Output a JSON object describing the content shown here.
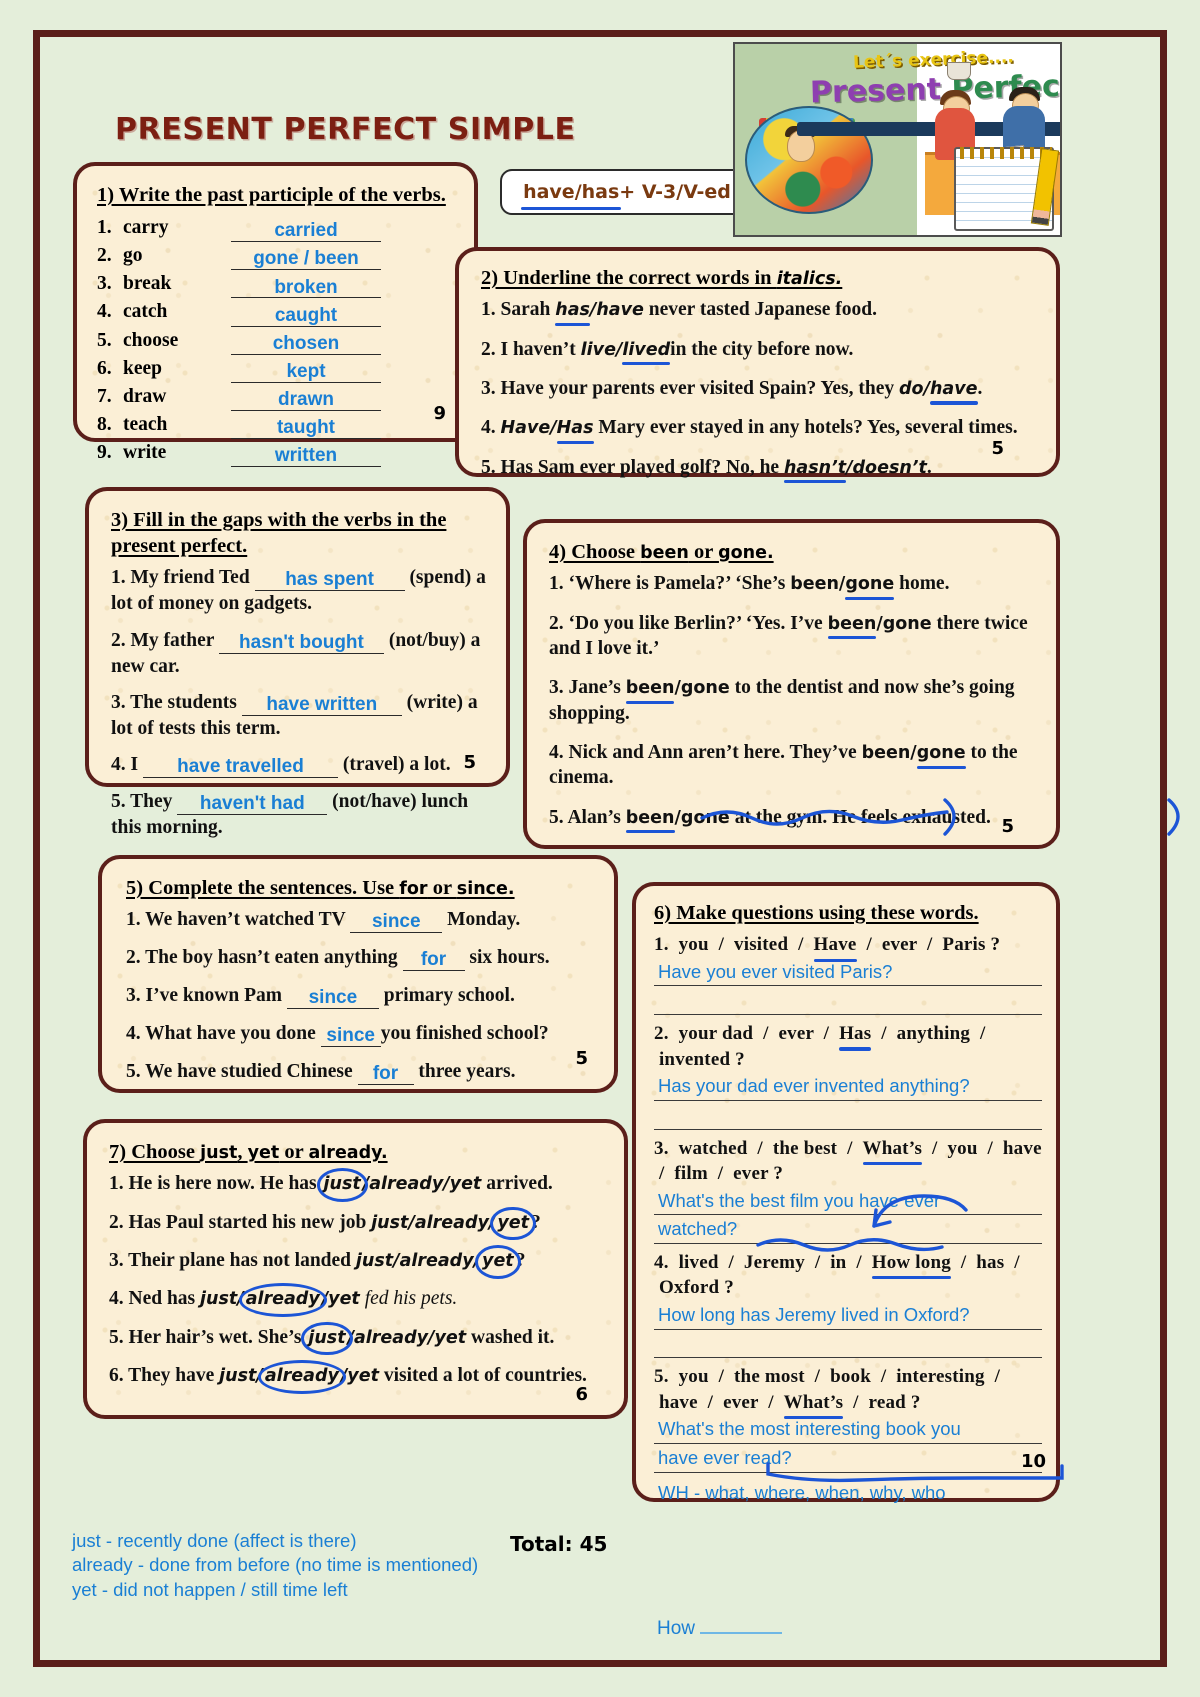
{
  "title": "PRESENT PERFECT SIMPLE",
  "formula": {
    "underlined": "have/has",
    "rest": " + V-3/V-ed"
  },
  "clipart": {
    "lets": "Let´s exercise....",
    "p1": "Present",
    "p2": " Perfect"
  },
  "ex1": {
    "heading": "1) Write the past participle of the verbs.",
    "items": [
      {
        "n": "1.",
        "verb": "carry",
        "answer": "carried"
      },
      {
        "n": "2.",
        "verb": "go",
        "answer": "gone / been"
      },
      {
        "n": "3.",
        "verb": "break",
        "answer": "broken"
      },
      {
        "n": "4.",
        "verb": "catch",
        "answer": "caught"
      },
      {
        "n": "5.",
        "verb": "choose",
        "answer": "chosen"
      },
      {
        "n": "6.",
        "verb": "keep",
        "answer": "kept"
      },
      {
        "n": "7.",
        "verb": "draw",
        "answer": "drawn"
      },
      {
        "n": "8.",
        "verb": "teach",
        "answer": "taught"
      },
      {
        "n": "9.",
        "verb": "write",
        "answer": "written"
      }
    ],
    "score": "9"
  },
  "ex2": {
    "heading_plain": "2) Underline the correct words in ",
    "heading_italic": "italics.",
    "items": [
      {
        "n": "1.",
        "pre": "Sarah ",
        "opt_a": "has",
        "opt_b": "have",
        "chosen": "a",
        "post": " never tasted Japanese food."
      },
      {
        "n": "2.",
        "pre": "I haven’t ",
        "opt_a": "live",
        "opt_b": "lived",
        "chosen": "b",
        "post": "in the city before now."
      },
      {
        "n": "3.",
        "pre": "Have your parents ever visited Spain? Yes, they ",
        "opt_a": "do",
        "opt_b": "have",
        "chosen": "b",
        "post": "."
      },
      {
        "n": "4.",
        "pre": "",
        "opt_a": "Have",
        "opt_b": "Has",
        "chosen": "b",
        "post": " Mary ever stayed in any hotels? Yes, several times."
      },
      {
        "n": "5.",
        "pre": "Has Sam ever played golf? No, he ",
        "opt_a": "hasn’t",
        "opt_b": "doesn’t",
        "chosen": "a",
        "post": "."
      }
    ],
    "score": "5"
  },
  "ex3": {
    "heading": "3) Fill in the gaps with the verbs in the present perfect.",
    "items": [
      {
        "n": "1.",
        "pre": "My friend Ted ",
        "answer": "has spent",
        "post": " (spend) a lot of money on gadgets."
      },
      {
        "n": "2.",
        "pre": "My father ",
        "answer": "hasn't bought",
        "post": " (not/buy) a new car."
      },
      {
        "n": "3.",
        "pre": "The students ",
        "answer": "have written",
        "post": " (write) a lot of tests this term."
      },
      {
        "n": "4.",
        "pre": "I ",
        "answer": "have travelled",
        "post": " (travel) a lot."
      },
      {
        "n": "5.",
        "pre": "They ",
        "answer": "haven't had",
        "post": " (not/have) lunch this morning."
      }
    ],
    "score": "5"
  },
  "ex4": {
    "heading_plain": "4) Choose ",
    "heading_b1": "been",
    "heading_or": " or ",
    "heading_b2": "gone.",
    "items": [
      {
        "n": "1.",
        "pre": "‘Where is Pamela?’ ‘She’s ",
        "opt_a": "been",
        "opt_b": "gone",
        "chosen": "b",
        "post": " home."
      },
      {
        "n": "2.",
        "pre": "‘Do you like Berlin?’ ‘Yes. I’ve ",
        "opt_a": "been",
        "opt_b": "gone",
        "chosen": "a",
        "post": " there twice and I love it.’"
      },
      {
        "n": "3.",
        "pre": "Jane’s ",
        "opt_a": "been",
        "opt_b": "gone",
        "chosen": "a",
        "post": " to the dentist and now she’s going shopping."
      },
      {
        "n": "4.",
        "pre": "Nick and Ann aren’t here. They’ve ",
        "opt_a": "been",
        "opt_b": "gone",
        "chosen": "b",
        "post": " to the cinema."
      },
      {
        "n": "5.",
        "pre": "Alan’s ",
        "opt_a": "been",
        "opt_b": "gone",
        "chosen": "a",
        "post": " at the gym. He feels exhausted."
      }
    ],
    "score": "5"
  },
  "ex5": {
    "heading_plain": "5) Complete the sentences. Use ",
    "heading_b1": "for",
    "heading_or": " or ",
    "heading_b2": "since.",
    "items": [
      {
        "n": "1.",
        "pre": "We haven’t watched TV ",
        "answer": "since",
        "post": " Monday."
      },
      {
        "n": "2.",
        "pre": "The boy hasn’t eaten anything ",
        "answer": "for",
        "post": " six hours."
      },
      {
        "n": "3.",
        "pre": "I’ve known Pam ",
        "answer": "since",
        "post": " primary school."
      },
      {
        "n": "4.",
        "pre": "What have you done ",
        "answer": "since",
        "post": "you finished school?"
      },
      {
        "n": "5.",
        "pre": "We have studied Chinese ",
        "answer": "for",
        "post": " three years."
      }
    ],
    "score": "5"
  },
  "ex6": {
    "heading": "6) Make questions using these words.",
    "items": [
      {
        "n": "1.",
        "words": [
          {
            "t": "you"
          },
          {
            "t": "/"
          },
          {
            "t": "visited"
          },
          {
            "t": "/"
          },
          {
            "t": "Have",
            "u": true
          },
          {
            "t": "/"
          },
          {
            "t": "ever"
          },
          {
            "t": "/"
          },
          {
            "t": "Paris ?"
          }
        ],
        "answer": "Have you ever visited Paris?",
        "answer2": ""
      },
      {
        "n": "2.",
        "words": [
          {
            "t": "your dad"
          },
          {
            "t": "/"
          },
          {
            "t": "ever"
          },
          {
            "t": "/"
          },
          {
            "t": "Has",
            "u": true
          },
          {
            "t": "/"
          },
          {
            "t": "anything"
          },
          {
            "t": "/"
          },
          {
            "t": "invented  ?"
          }
        ],
        "answer": "Has your dad ever invented anything?",
        "answer2": ""
      },
      {
        "n": "3.",
        "words": [
          {
            "t": "watched"
          },
          {
            "t": "/"
          },
          {
            "t": "the best"
          },
          {
            "t": "/"
          },
          {
            "t": "What’s",
            "u": true
          },
          {
            "t": "/"
          },
          {
            "t": "you"
          },
          {
            "t": "/"
          },
          {
            "t": "have"
          },
          {
            "t": "/"
          },
          {
            "t": "film"
          },
          {
            "t": "/"
          },
          {
            "t": "ever  ?"
          }
        ],
        "answer": "What's the best film you have ever",
        "answer2": "watched?"
      },
      {
        "n": "4.",
        "words": [
          {
            "t": "lived"
          },
          {
            "t": "/"
          },
          {
            "t": "Jeremy"
          },
          {
            "t": "/"
          },
          {
            "t": "in"
          },
          {
            "t": "/"
          },
          {
            "t": "How long",
            "u": true
          },
          {
            "t": "/"
          },
          {
            "t": "has"
          },
          {
            "t": "/"
          },
          {
            "t": "Oxford  ?"
          }
        ],
        "answer": "How long has Jeremy lived in Oxford?",
        "answer2": ""
      },
      {
        "n": "5.",
        "words": [
          {
            "t": "you"
          },
          {
            "t": "/"
          },
          {
            "t": "the most"
          },
          {
            "t": "/"
          },
          {
            "t": "book"
          },
          {
            "t": "/"
          },
          {
            "t": "interesting"
          },
          {
            "t": "/"
          },
          {
            "t": "have"
          },
          {
            "t": "/"
          },
          {
            "t": "ever"
          },
          {
            "t": "/"
          },
          {
            "t": "What’s",
            "u": true
          },
          {
            "t": "/"
          },
          {
            "t": "read  ?"
          }
        ],
        "answer": "What's the most interesting book you",
        "answer2": "have ever read?"
      }
    ],
    "note": "WH - what, where, when, why, who",
    "score": "10"
  },
  "ex7": {
    "heading_plain": "7) Choose ",
    "heading_b1": "just",
    "heading_c1": ", ",
    "heading_b2": "yet",
    "heading_or": " or ",
    "heading_b3": "already.",
    "items": [
      {
        "n": "1.",
        "pre": "He is here now. He has ",
        "opts": [
          "just",
          "already",
          "yet"
        ],
        "chosen": 0,
        "post": " arrived.",
        "post_italic": false
      },
      {
        "n": "2.",
        "pre": "Has Paul started his new job ",
        "opts": [
          "just",
          "already",
          "yet"
        ],
        "chosen": 2,
        "post": "?",
        "post_italic": false
      },
      {
        "n": "3.",
        "pre": "Their plane has not landed ",
        "opts": [
          "just",
          "already",
          "yet"
        ],
        "chosen": 2,
        "post": "?",
        "post_italic": false
      },
      {
        "n": "4.",
        "pre": "Ned has ",
        "opts": [
          "just",
          "already",
          "yet"
        ],
        "chosen": 1,
        "post": " fed his pets.",
        "post_italic": true
      },
      {
        "n": "5.",
        "pre": "Her hair’s wet. She’s ",
        "opts": [
          "just",
          "already",
          "yet"
        ],
        "chosen": 0,
        "post": " washed it.",
        "post_italic": false
      },
      {
        "n": "6.",
        "pre": "They have ",
        "opts": [
          "just",
          "already",
          "yet"
        ],
        "chosen": 1,
        "post": " visited a lot of countries.",
        "post_italic": false
      }
    ],
    "score": "6"
  },
  "footnote": {
    "l1": "just - recently done (affect is there)",
    "l2": "already - done from before (no time is mentioned)",
    "l3": "yet - did not happen / still time left"
  },
  "total_label": "Total: 45",
  "how_label": "How"
}
